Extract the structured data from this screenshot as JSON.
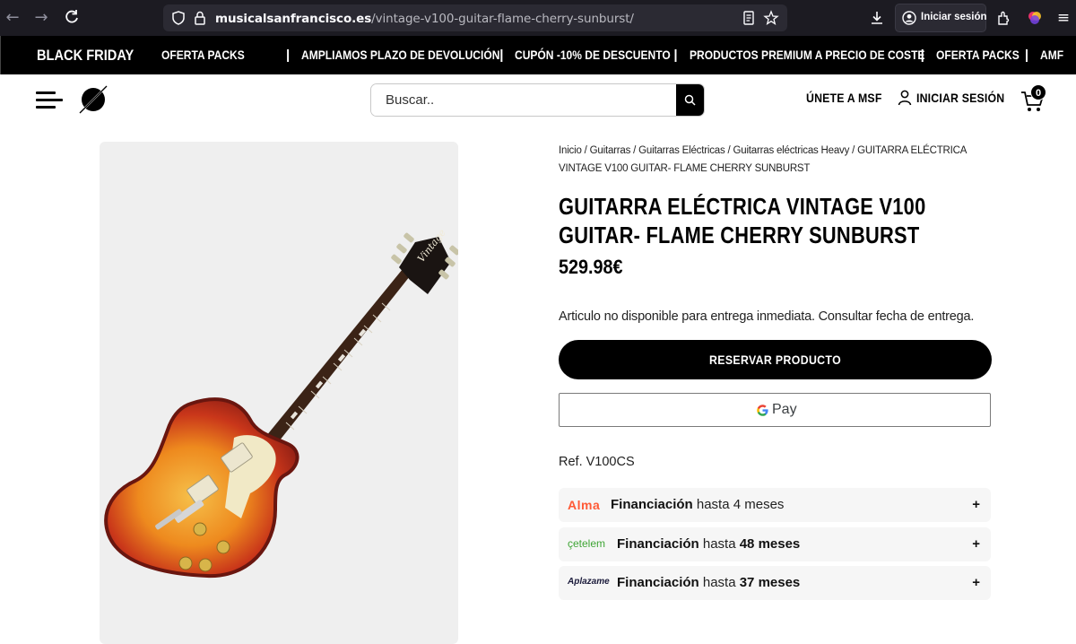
{
  "browser": {
    "url_domain": "musicalsanfrancisco.es",
    "url_path": "/vintage-v100-guitar-flame-cherry-sunburst/",
    "signin_label": "Iniciar sesión"
  },
  "ticker": {
    "lead": "BLACK FRIDAY",
    "items": [
      "OFERTA PACKS",
      "AMPLIAMOS PLAZO DE DEVOLUCIÓN",
      "CUPÓN -10% DE DESCUENTO",
      "PRODUCTOS PREMIUM A PRECIO DE COSTE",
      "OFERTA PACKS",
      "AMF"
    ],
    "separator": "|"
  },
  "header": {
    "search_placeholder": "Buscar..",
    "join_label": "ÚNETE A MSF",
    "login_label": "INICIAR SESIÓN",
    "cart_count": "0"
  },
  "product": {
    "breadcrumb": {
      "items": [
        "Inicio",
        "Guitarras",
        "Guitarras Eléctricas",
        "Guitarras eléctricas Heavy"
      ],
      "sep": " / ",
      "current": "GUITARRA ELÉCTRICA VINTAGE V100 GUITAR- FLAME CHERRY SUNBURST"
    },
    "title": "GUITARRA ELÉCTRICA VINTAGE V100 GUITAR- FLAME CHERRY SUNBURST",
    "price": "529.98€",
    "availability": "Articulo no disponible para entrega inmediata. Consultar fecha de entrega.",
    "reserve_label": "RESERVAR PRODUCTO",
    "gpay_label": "Pay",
    "ref": "Ref. V100CS",
    "headstock_text": "Vintage"
  },
  "financing": [
    {
      "brand": "Alma",
      "brand_color": "#ff5a36",
      "label": "Financiación",
      "mid": " hasta ",
      "term": "4 meses",
      "term_bold": false
    },
    {
      "brand": "çetelem",
      "brand_color": "#3fa535",
      "label": "Financiación",
      "mid": " hasta ",
      "term": "48 meses",
      "term_bold": true
    },
    {
      "brand": "Aplazame",
      "brand_color": "#1a1a3a",
      "label": "Financiación",
      "mid": " hasta ",
      "term": "37 meses",
      "term_bold": true
    }
  ],
  "colors": {
    "chrome_bg": "#1c1b22",
    "ticker_bg": "#000000",
    "accent": "#000000",
    "gallery_bg": "#efefef"
  }
}
